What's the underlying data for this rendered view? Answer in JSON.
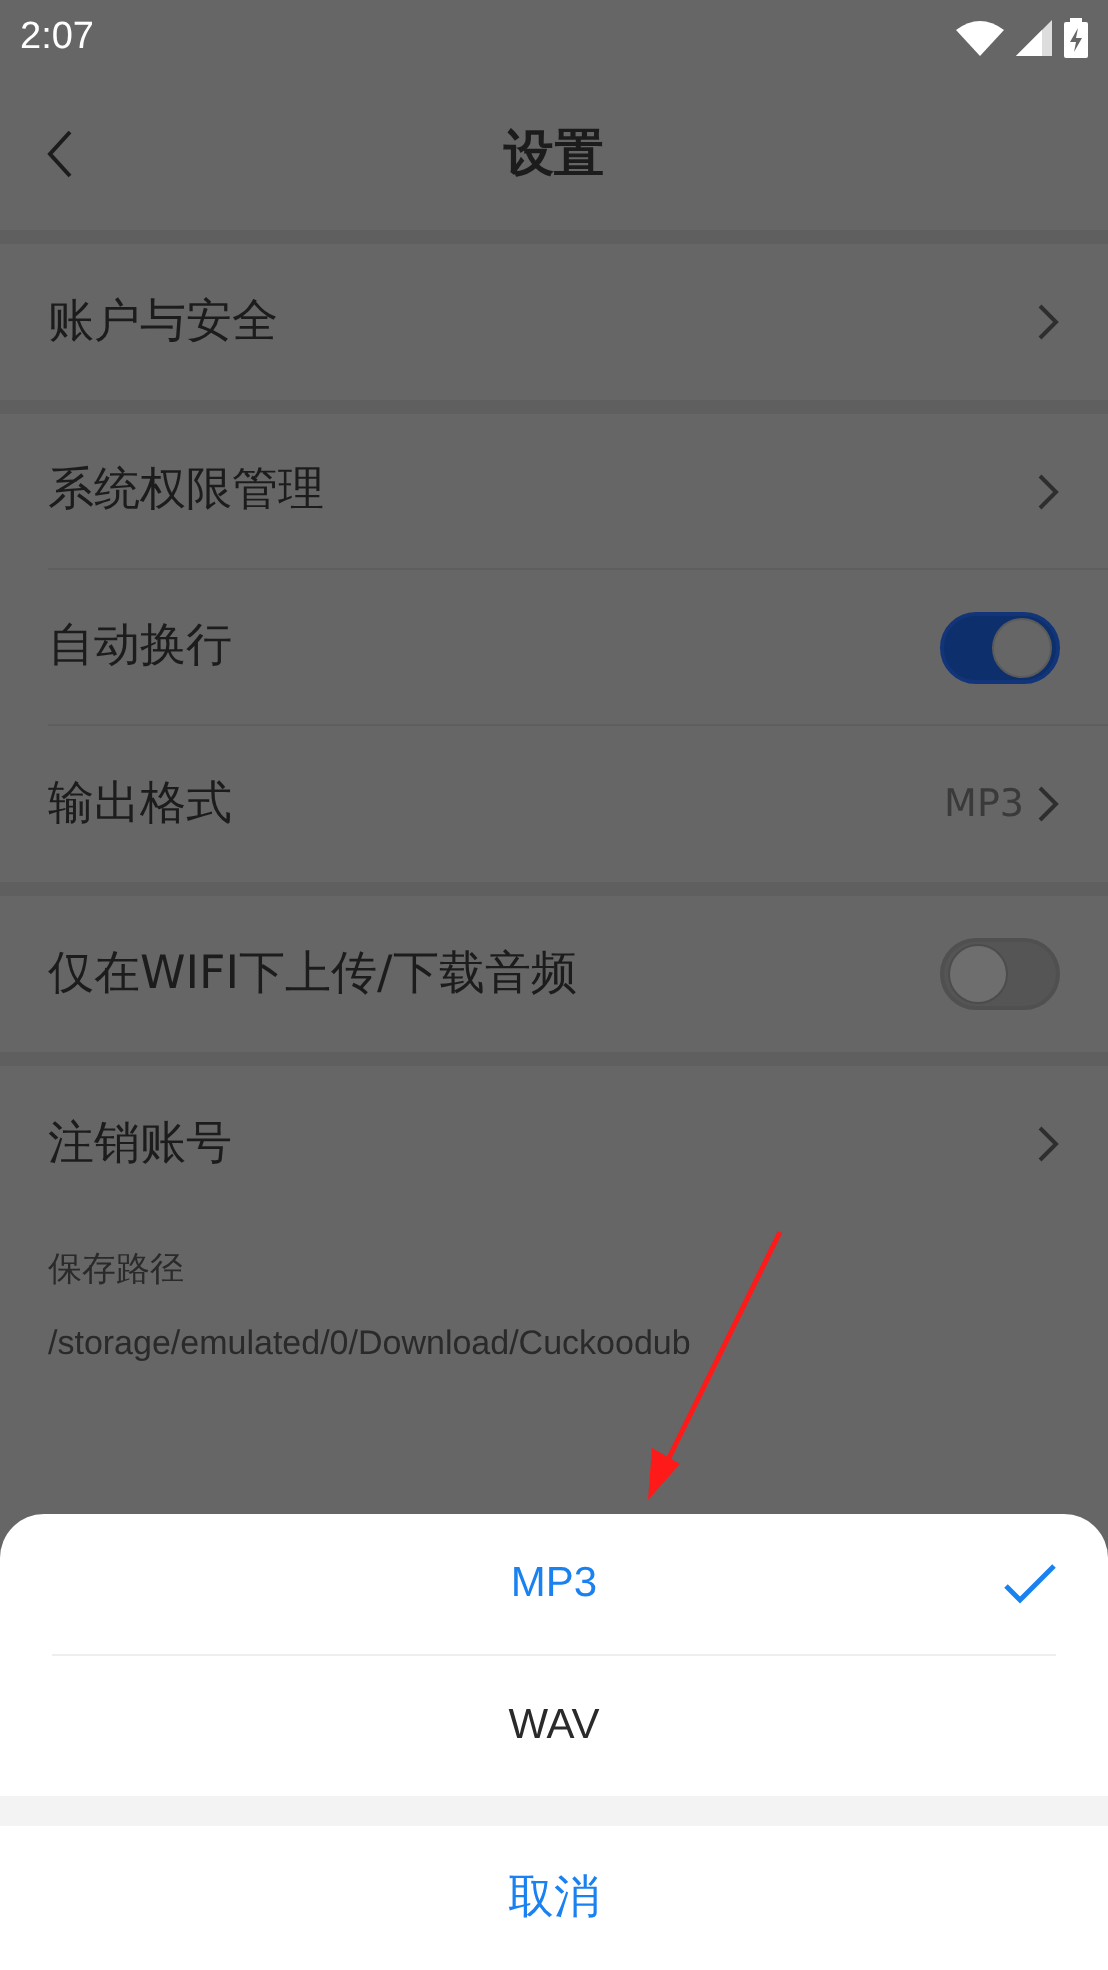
{
  "status_bar": {
    "time": "2:07"
  },
  "header": {
    "title": "设置"
  },
  "groups": [
    {
      "items": [
        {
          "kind": "nav",
          "label": "账户与安全"
        }
      ]
    },
    {
      "items": [
        {
          "kind": "nav",
          "label": "系统权限管理"
        },
        {
          "kind": "toggle",
          "label": "自动换行",
          "on": true
        },
        {
          "kind": "value",
          "label": "输出格式",
          "value": "MP3"
        }
      ]
    },
    {
      "items": [
        {
          "kind": "toggle",
          "label": "仅在WIFI下上传/下载音频",
          "on": false
        }
      ]
    },
    {
      "items": [
        {
          "kind": "nav",
          "label": "注销账号"
        }
      ]
    }
  ],
  "save_path": {
    "label": "保存路径",
    "path": "/storage/emulated/0/Download/Cuckoodub"
  },
  "sheet": {
    "options": [
      {
        "label": "MP3",
        "selected": true
      },
      {
        "label": "WAV",
        "selected": false
      }
    ],
    "cancel": "取消"
  }
}
